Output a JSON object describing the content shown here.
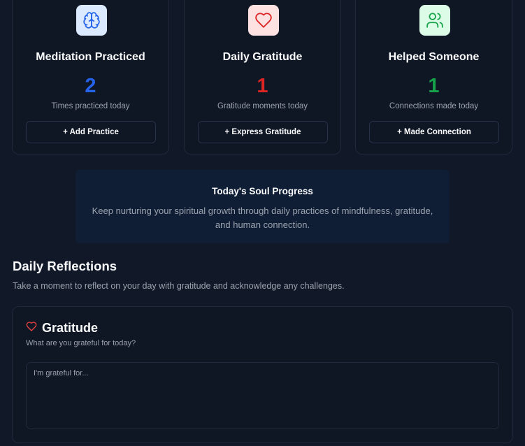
{
  "cards": [
    {
      "title": "Meditation Practiced",
      "count": "2",
      "subtitle": "Times practiced today",
      "button": "+ Add Practice",
      "icon": "brain-icon",
      "color": "#2563eb"
    },
    {
      "title": "Daily Gratitude",
      "count": "1",
      "subtitle": "Gratitude moments today",
      "button": "+ Express Gratitude",
      "icon": "heart-icon",
      "color": "#dc2626"
    },
    {
      "title": "Helped Someone",
      "count": "1",
      "subtitle": "Connections made today",
      "button": "+ Made Connection",
      "icon": "users-icon",
      "color": "#16a34a"
    }
  ],
  "progress": {
    "title": "Today's Soul Progress",
    "text": "Keep nurturing your spiritual growth through daily practices of mindfulness, gratitude, and human connection."
  },
  "reflections": {
    "title": "Daily Reflections",
    "subtitle": "Take a moment to reflect on your day with gratitude and acknowledge any challenges."
  },
  "gratitude": {
    "title": "Gratitude",
    "subtitle": "What are you grateful for today?",
    "value": "",
    "placeholder": "I'm grateful for..."
  }
}
